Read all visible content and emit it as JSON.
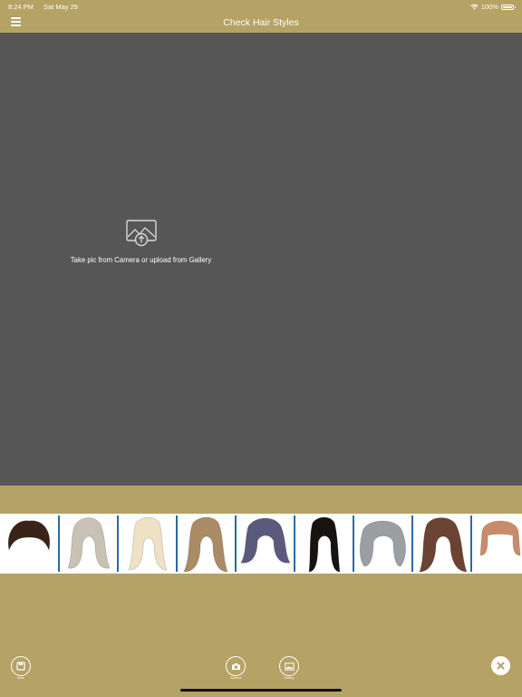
{
  "status": {
    "time": "8:24 PM",
    "date": "Sat May 29",
    "battery": "100%",
    "battery_level": 1.0
  },
  "nav": {
    "title": "Check Hair Styles"
  },
  "upload": {
    "prompt": "Take pic from Camera or upload from Gallery"
  },
  "hairstyles": [
    {
      "name": "short-dark-spiky",
      "color": "#3a2418"
    },
    {
      "name": "long-wavy-ash-blonde",
      "color": "#c9c2b4"
    },
    {
      "name": "long-wavy-platinum",
      "color": "#efe1c4"
    },
    {
      "name": "long-wavy-balayage",
      "color": "#a98b66"
    },
    {
      "name": "wavy-purple-ombre",
      "color": "#5a5a7c"
    },
    {
      "name": "long-straight-black",
      "color": "#171311"
    },
    {
      "name": "wavy-silver-bob",
      "color": "#9b9fa3"
    },
    {
      "name": "long-curly-brunette",
      "color": "#6a4332"
    },
    {
      "name": "bob-with-bangs",
      "color": "#c98c6a"
    }
  ],
  "toolbar": {
    "save_label": "Save",
    "camera_label": "Camera",
    "gallery_label": "Gallery"
  },
  "colors": {
    "accent": "#b5a265",
    "canvas": "#565656",
    "divider": "#2b69a6"
  }
}
